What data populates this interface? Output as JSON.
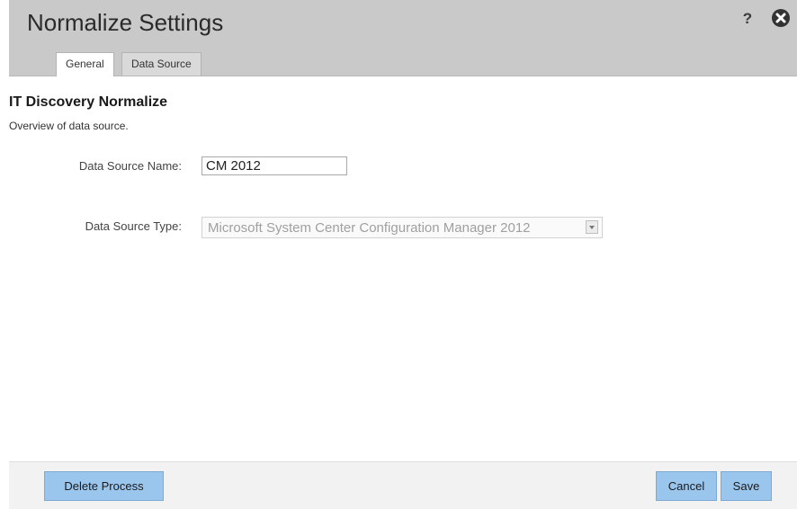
{
  "header": {
    "title": "Normalize Settings",
    "help_label": "?",
    "help_icon": "question-icon",
    "close_icon": "close-circle-icon"
  },
  "tabs": [
    {
      "label": "General",
      "active": true
    },
    {
      "label": "Data Source",
      "active": false
    }
  ],
  "section": {
    "title": "IT Discovery Normalize",
    "description": "Overview of data source."
  },
  "fields": {
    "name": {
      "label": "Data Source Name:",
      "value": "CM 2012"
    },
    "type": {
      "label": "Data Source Type:",
      "value": "Microsoft System Center Configuration Manager 2012",
      "disabled": true
    }
  },
  "footer": {
    "delete_label": "Delete Process",
    "cancel_label": "Cancel",
    "save_label": "Save"
  },
  "colors": {
    "header_bg": "#c9c9c9",
    "button_bg": "#9ac6ee",
    "footer_bg": "#f2f2f2"
  }
}
